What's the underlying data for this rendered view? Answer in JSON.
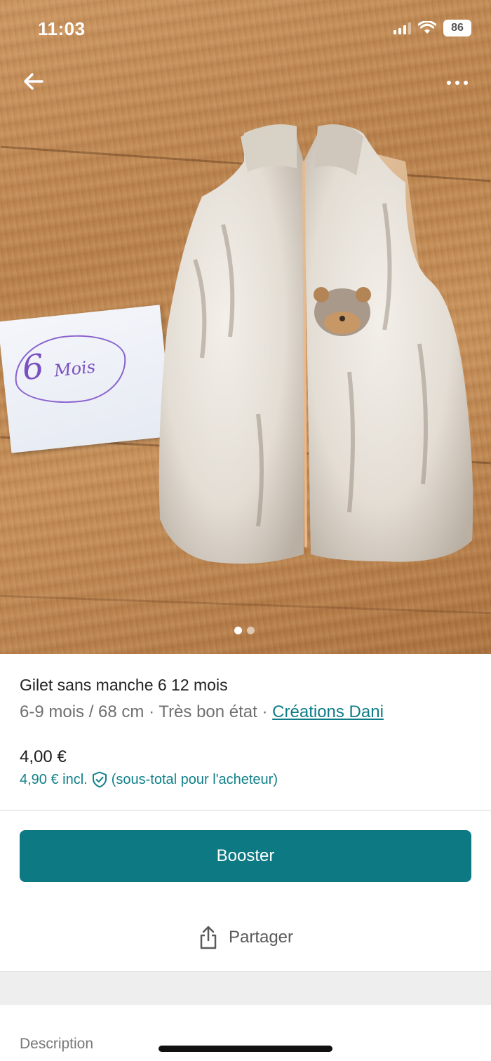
{
  "status_bar": {
    "time": "11:03",
    "battery": "86"
  },
  "nav": {
    "back_icon": "arrow-left-icon",
    "more_icon": "ellipsis-icon"
  },
  "photo": {
    "paper_note_number": "6",
    "paper_note_word": "Mois",
    "carousel_count": 2,
    "carousel_active": 1
  },
  "listing": {
    "title": "Gilet sans manche 6 12 mois",
    "size": "6-9 mois / 68 cm",
    "separator": "·",
    "condition": "Très bon état",
    "brand": "Créations Dani",
    "price": "4,00 €",
    "price_incl": "4,90 € incl.",
    "price_incl_note": "(sous-total pour l'acheteur)",
    "shield_icon": "shield-check-icon"
  },
  "actions": {
    "booster_label": "Booster",
    "share_label": "Partager",
    "share_icon": "share-icon"
  },
  "sections": {
    "description_label": "Description"
  },
  "colors": {
    "accent": "#0d7983",
    "link": "#0e7d86",
    "text": "#1c1c1c",
    "muted": "#6f6f6f"
  }
}
